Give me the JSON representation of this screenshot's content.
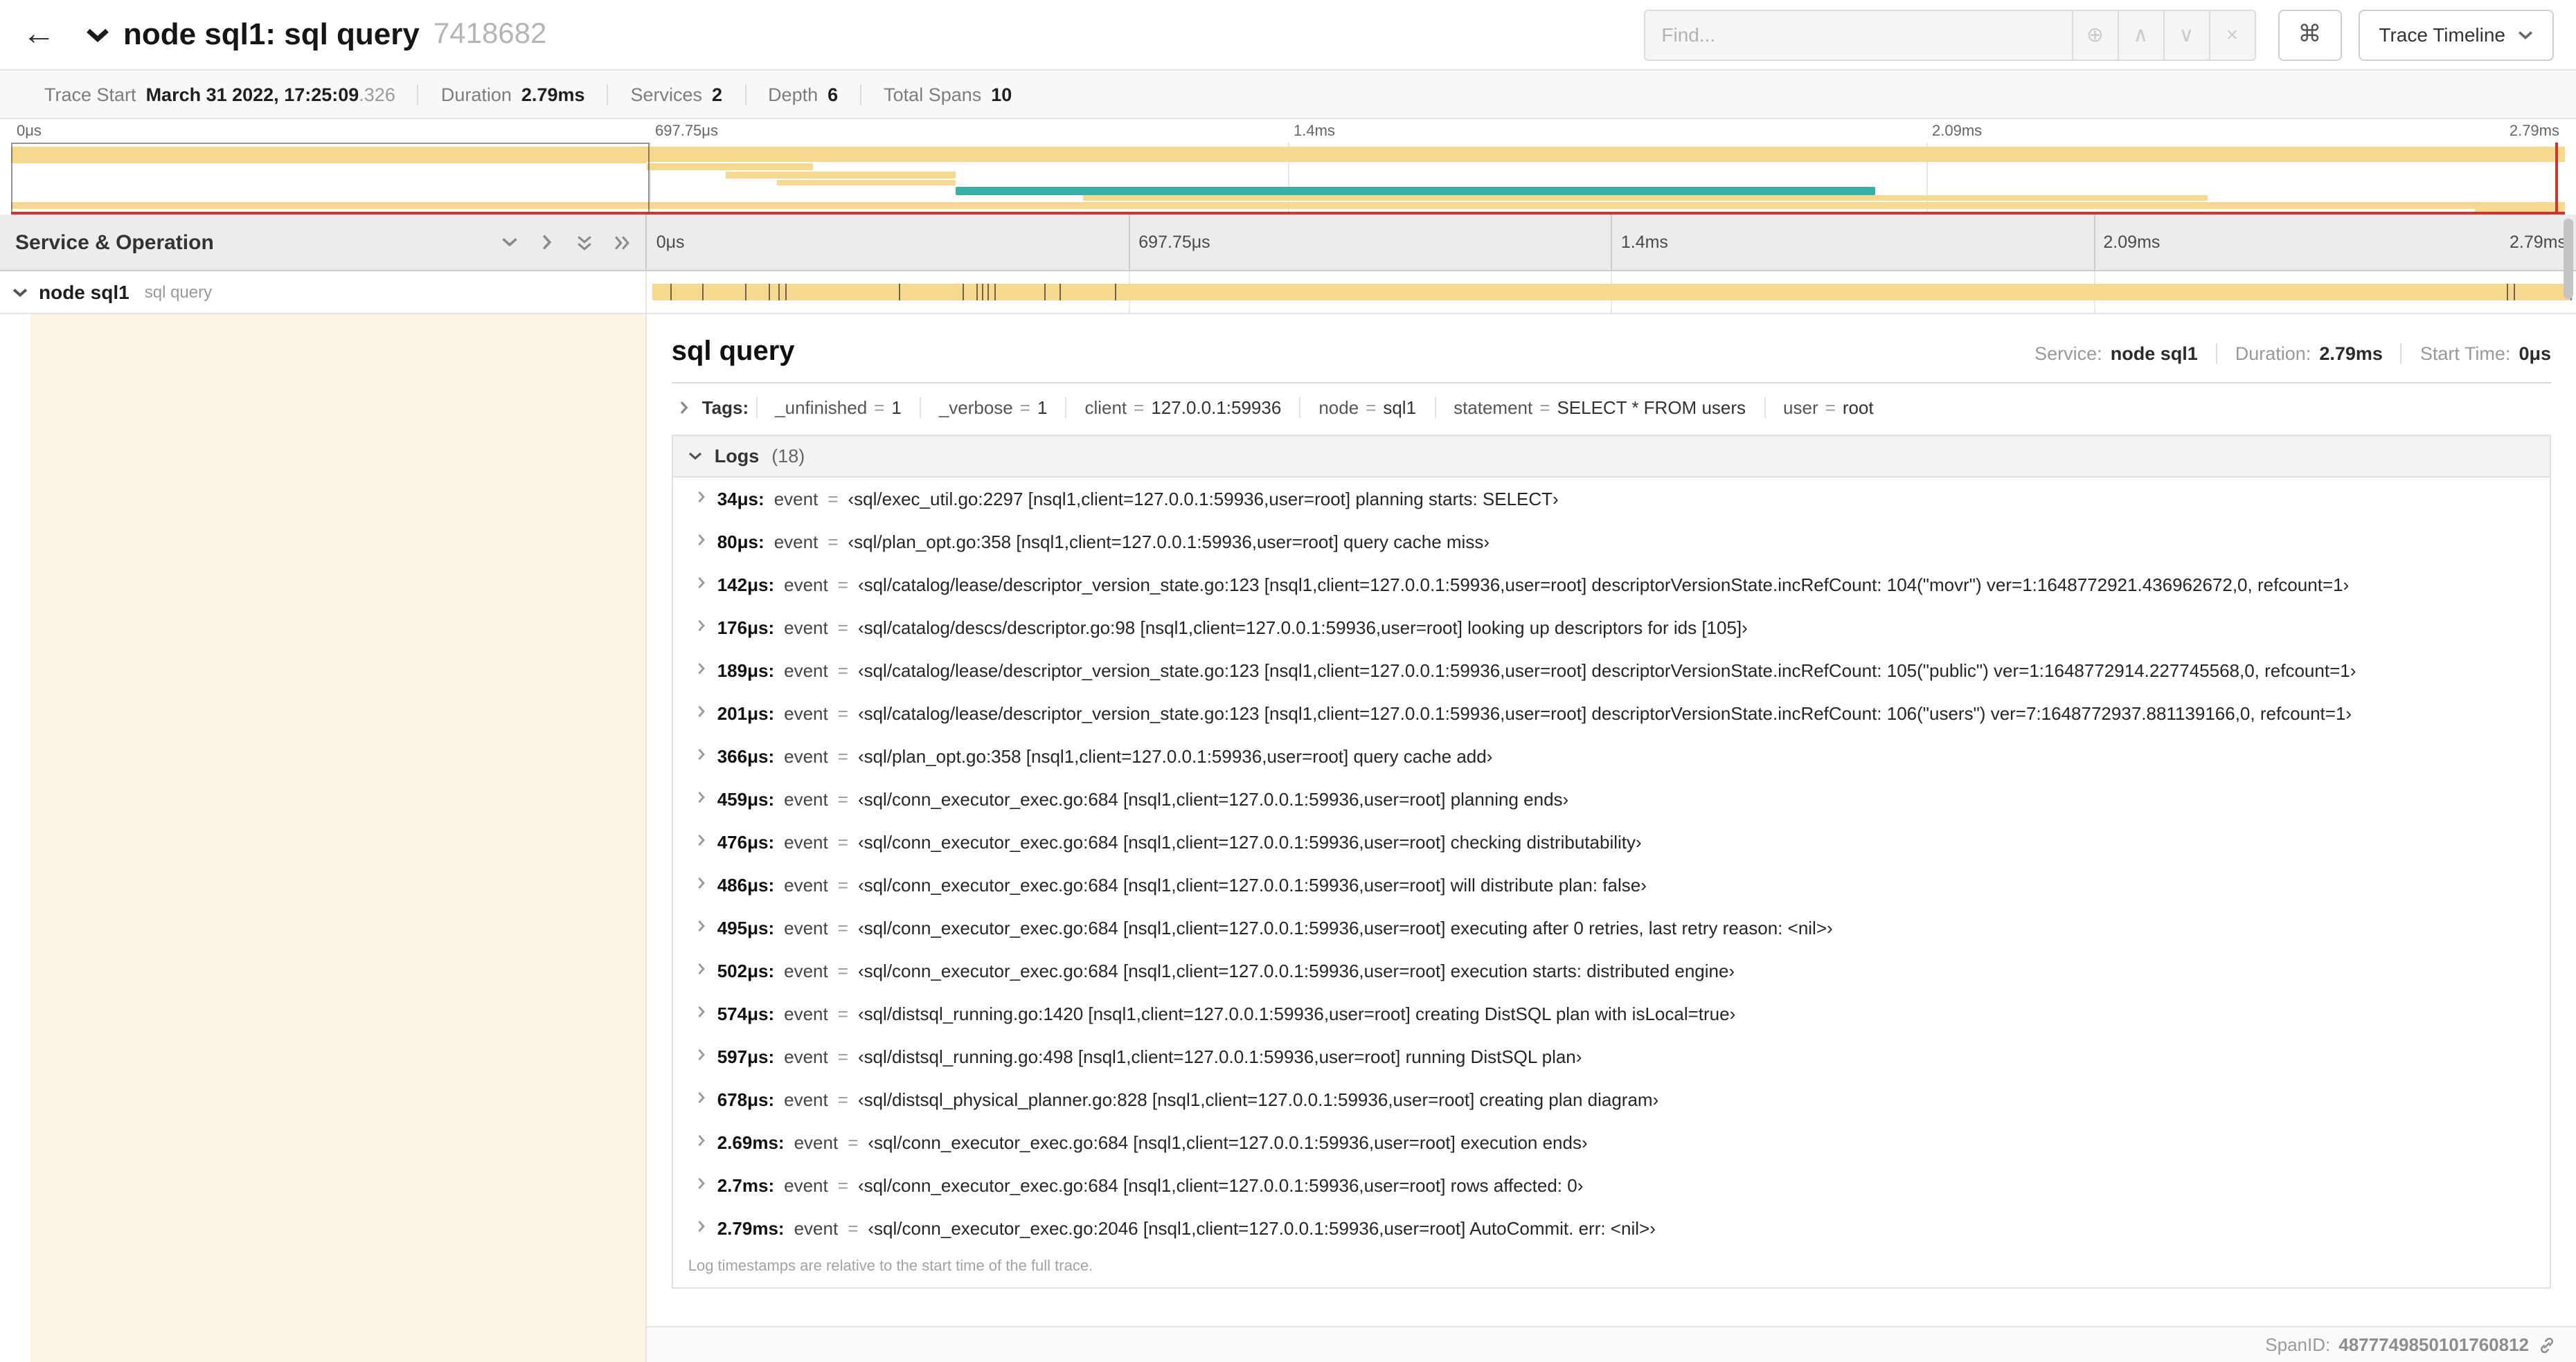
{
  "colors": {
    "span_tan": "#F6D88F",
    "span_teal": "#36B1A8",
    "cream": "#FCF5E3",
    "red": "#D0342C"
  },
  "icons": {
    "back": "←",
    "zoom": "⊕",
    "prev": "∧",
    "next": "∨",
    "clear": "×",
    "command": "⌘"
  },
  "header": {
    "title": "node sql1: sql query",
    "trace_id": "7418682",
    "find_placeholder": "Find...",
    "view_button": "Trace Timeline"
  },
  "trace_info": [
    {
      "label": "Trace Start",
      "value": "March 31 2022, 17:25:09",
      "suffix": ".326"
    },
    {
      "label": "Duration",
      "value": "2.79ms",
      "suffix": ""
    },
    {
      "label": "Services",
      "value": "2",
      "suffix": ""
    },
    {
      "label": "Depth",
      "value": "6",
      "suffix": ""
    },
    {
      "label": "Total Spans",
      "value": "10",
      "suffix": ""
    }
  ],
  "timeline": {
    "left_header": "Service & Operation",
    "ticks": [
      {
        "label": "0μs",
        "left": "0%",
        "tx": "none"
      },
      {
        "label": "697.75μs",
        "left": "25%",
        "tx": "none"
      },
      {
        "label": "1.4ms",
        "left": "50%",
        "tx": "none"
      },
      {
        "label": "2.09ms",
        "left": "75%",
        "tx": "none"
      },
      {
        "label": "2.79ms",
        "left": "100%",
        "tx": "translateX(-100%)"
      }
    ],
    "gridlines": [
      "25%",
      "50%",
      "75%"
    ],
    "row": {
      "service": "node sql1",
      "operation": "sql query"
    },
    "event_marks": [
      "1.2%",
      "2.9%",
      "5.1%",
      "6.3%",
      "6.8%",
      "7.2%",
      "13.1%",
      "16.4%",
      "17.1%",
      "17.4%",
      "17.7%",
      "18%",
      "20.6%",
      "21.4%",
      "24.3%",
      "96.4%",
      "96.8%",
      "99.7%"
    ]
  },
  "minimap": {
    "spans": [
      {
        "left": "0%",
        "width": "100%",
        "top": "6%",
        "height": "12%",
        "color": "#F6D88F"
      },
      {
        "left": "0%",
        "width": "24.9%",
        "top": "18%",
        "height": "12%",
        "color": "#F6D88F"
      },
      {
        "left": "24.9%",
        "width": "75.1%",
        "top": "18%",
        "height": "10%",
        "color": "#F6D88F"
      },
      {
        "left": "24.9%",
        "width": "6.5%",
        "top": "30%",
        "height": "10%",
        "color": "#F6D88F"
      },
      {
        "left": "28%",
        "width": "9%",
        "top": "41%",
        "height": "10%",
        "color": "#F6D88F"
      },
      {
        "left": "30%",
        "width": "7%",
        "top": "52%",
        "height": "9%",
        "color": "#F6D88F"
      },
      {
        "left": "37%",
        "width": "36%",
        "top": "62%",
        "height": "12%",
        "color": "#36B1A8"
      },
      {
        "left": "42%",
        "width": "44%",
        "top": "74%",
        "height": "9%",
        "color": "#F6D88F"
      },
      {
        "left": "0%",
        "width": "100%",
        "top": "84%",
        "height": "10%",
        "color": "#F6D88F"
      },
      {
        "left": "96.5%",
        "width": "3.5%",
        "top": "94%",
        "height": "6%",
        "color": "#F6D88F"
      }
    ]
  },
  "detail": {
    "title": "sql query",
    "eq": "=",
    "stats": [
      {
        "label": "Service:",
        "value": "node sql1"
      },
      {
        "label": "Duration:",
        "value": "2.79ms"
      },
      {
        "label": "Start Time:",
        "value": "0μs"
      }
    ],
    "tags_label": "Tags:",
    "tags": [
      {
        "key": "_unfinished",
        "value": "1"
      },
      {
        "key": "_verbose",
        "value": "1"
      },
      {
        "key": "client",
        "value": "127.0.0.1:59936"
      },
      {
        "key": "node",
        "value": "sql1"
      },
      {
        "key": "statement",
        "value": "SELECT * FROM users"
      },
      {
        "key": "user",
        "value": "root"
      }
    ],
    "logs_label": "Logs",
    "logs_count": "(18)",
    "log_key": "event",
    "logs": [
      {
        "time": "34μs:",
        "value": "‹sql/exec_util.go:2297 [nsql1,client=127.0.0.1:59936,user=root] planning starts: SELECT›"
      },
      {
        "time": "80μs:",
        "value": "‹sql/plan_opt.go:358 [nsql1,client=127.0.0.1:59936,user=root] query cache miss›"
      },
      {
        "time": "142μs:",
        "value": "‹sql/catalog/lease/descriptor_version_state.go:123 [nsql1,client=127.0.0.1:59936,user=root] descriptorVersionState.incRefCount: 104(\"movr\") ver=1:1648772921.436962672,0, refcount=1›"
      },
      {
        "time": "176μs:",
        "value": "‹sql/catalog/descs/descriptor.go:98 [nsql1,client=127.0.0.1:59936,user=root] looking up descriptors for ids [105]›"
      },
      {
        "time": "189μs:",
        "value": "‹sql/catalog/lease/descriptor_version_state.go:123 [nsql1,client=127.0.0.1:59936,user=root] descriptorVersionState.incRefCount: 105(\"public\") ver=1:1648772914.227745568,0, refcount=1›"
      },
      {
        "time": "201μs:",
        "value": "‹sql/catalog/lease/descriptor_version_state.go:123 [nsql1,client=127.0.0.1:59936,user=root] descriptorVersionState.incRefCount: 106(\"users\") ver=7:1648772937.881139166,0, refcount=1›"
      },
      {
        "time": "366μs:",
        "value": "‹sql/plan_opt.go:358 [nsql1,client=127.0.0.1:59936,user=root] query cache add›"
      },
      {
        "time": "459μs:",
        "value": "‹sql/conn_executor_exec.go:684 [nsql1,client=127.0.0.1:59936,user=root] planning ends›"
      },
      {
        "time": "476μs:",
        "value": "‹sql/conn_executor_exec.go:684 [nsql1,client=127.0.0.1:59936,user=root] checking distributability›"
      },
      {
        "time": "486μs:",
        "value": "‹sql/conn_executor_exec.go:684 [nsql1,client=127.0.0.1:59936,user=root] will distribute plan: false›"
      },
      {
        "time": "495μs:",
        "value": "‹sql/conn_executor_exec.go:684 [nsql1,client=127.0.0.1:59936,user=root] executing after 0 retries, last retry reason: <nil>›"
      },
      {
        "time": "502μs:",
        "value": "‹sql/conn_executor_exec.go:684 [nsql1,client=127.0.0.1:59936,user=root] execution starts: distributed engine›"
      },
      {
        "time": "574μs:",
        "value": "‹sql/distsql_running.go:1420 [nsql1,client=127.0.0.1:59936,user=root] creating DistSQL plan with isLocal=true›"
      },
      {
        "time": "597μs:",
        "value": "‹sql/distsql_running.go:498 [nsql1,client=127.0.0.1:59936,user=root] running DistSQL plan›"
      },
      {
        "time": "678μs:",
        "value": "‹sql/distsql_physical_planner.go:828 [nsql1,client=127.0.0.1:59936,user=root] creating plan diagram›"
      },
      {
        "time": "2.69ms:",
        "value": "‹sql/conn_executor_exec.go:684 [nsql1,client=127.0.0.1:59936,user=root] execution ends›"
      },
      {
        "time": "2.7ms:",
        "value": "‹sql/conn_executor_exec.go:684 [nsql1,client=127.0.0.1:59936,user=root] rows affected: 0›"
      },
      {
        "time": "2.79ms:",
        "value": "‹sql/conn_executor_exec.go:2046 [nsql1,client=127.0.0.1:59936,user=root] AutoCommit. err: <nil>›"
      }
    ],
    "footer_note": "Log timestamps are relative to the start time of the full trace.",
    "span_id_label": "SpanID:",
    "span_id": "4877749850101760812"
  }
}
